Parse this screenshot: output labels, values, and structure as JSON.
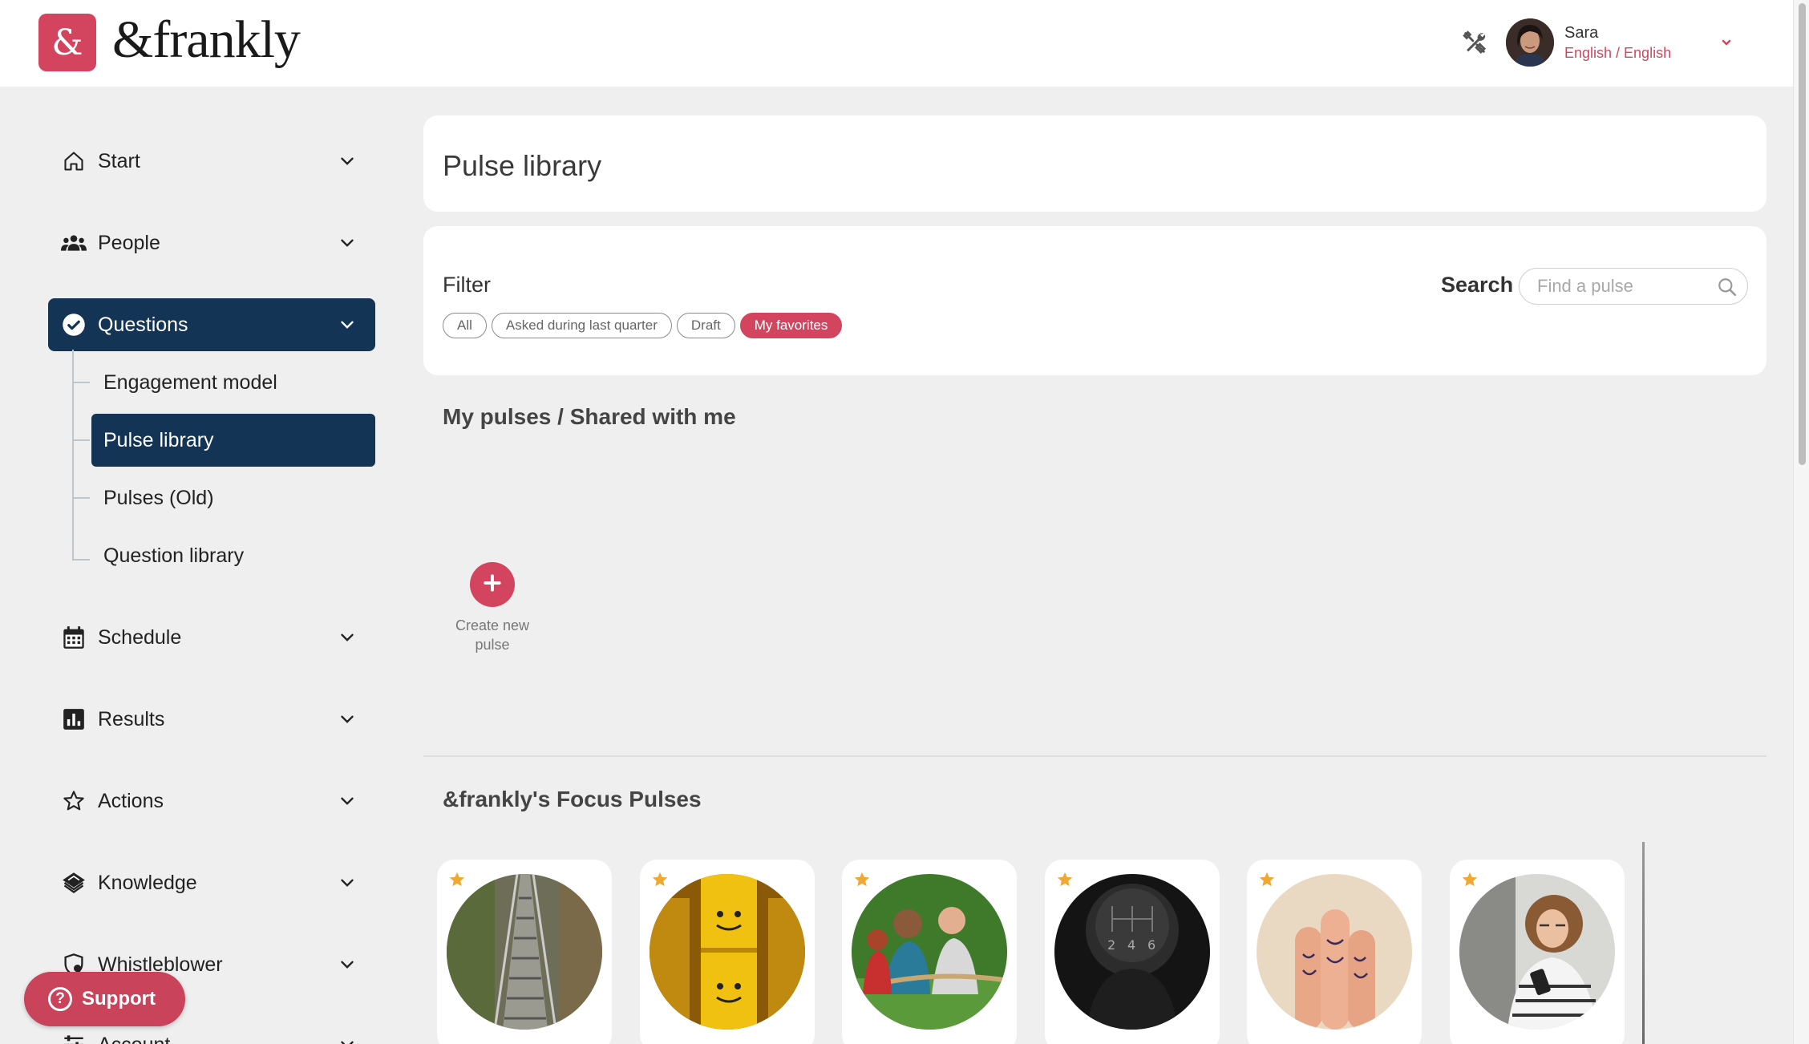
{
  "header": {
    "logo_symbol": "&",
    "logo_text": "&frankly",
    "tools_icon": "tools-icon",
    "user_name": "Sara",
    "user_language": "English / English",
    "accent_color": "#d3455f"
  },
  "sidebar": {
    "items": [
      {
        "label": "Start",
        "icon": "home-icon"
      },
      {
        "label": "People",
        "icon": "people-icon"
      },
      {
        "label": "Questions",
        "icon": "check-circle-icon"
      },
      {
        "label": "Schedule",
        "icon": "calendar-icon"
      },
      {
        "label": "Results",
        "icon": "bar-chart-icon"
      },
      {
        "label": "Actions",
        "icon": "star-outline-icon"
      },
      {
        "label": "Knowledge",
        "icon": "knowledge-icon"
      },
      {
        "label": "Whistleblower",
        "icon": "shield-icon"
      },
      {
        "label": "Account",
        "icon": "sliders-icon"
      }
    ],
    "questions_sub": [
      {
        "label": "Engagement model"
      },
      {
        "label": "Pulse library"
      },
      {
        "label": "Pulses (Old)"
      },
      {
        "label": "Question library"
      }
    ],
    "active_color": "#143456"
  },
  "support": {
    "label": "Support"
  },
  "main": {
    "title": "Pulse library",
    "filter": {
      "label": "Filter",
      "chips": [
        "All",
        "Asked during last quarter",
        "Draft",
        "My favorites"
      ],
      "selected": "My favorites"
    },
    "search": {
      "label": "Search",
      "placeholder": "Find a pulse"
    },
    "my_pulses_title": "My pulses / Shared with me",
    "create_label": "Create new pulse",
    "focus_title": "&frankly's Focus Pulses",
    "focus_cards": [
      {
        "image": "stairs",
        "favorite": true
      },
      {
        "image": "toy-faces",
        "favorite": true
      },
      {
        "image": "tug-of-war",
        "favorite": true
      },
      {
        "image": "gear-shift",
        "favorite": true
      },
      {
        "image": "finger-faces",
        "favorite": true
      },
      {
        "image": "woman-phone",
        "favorite": true
      }
    ]
  }
}
